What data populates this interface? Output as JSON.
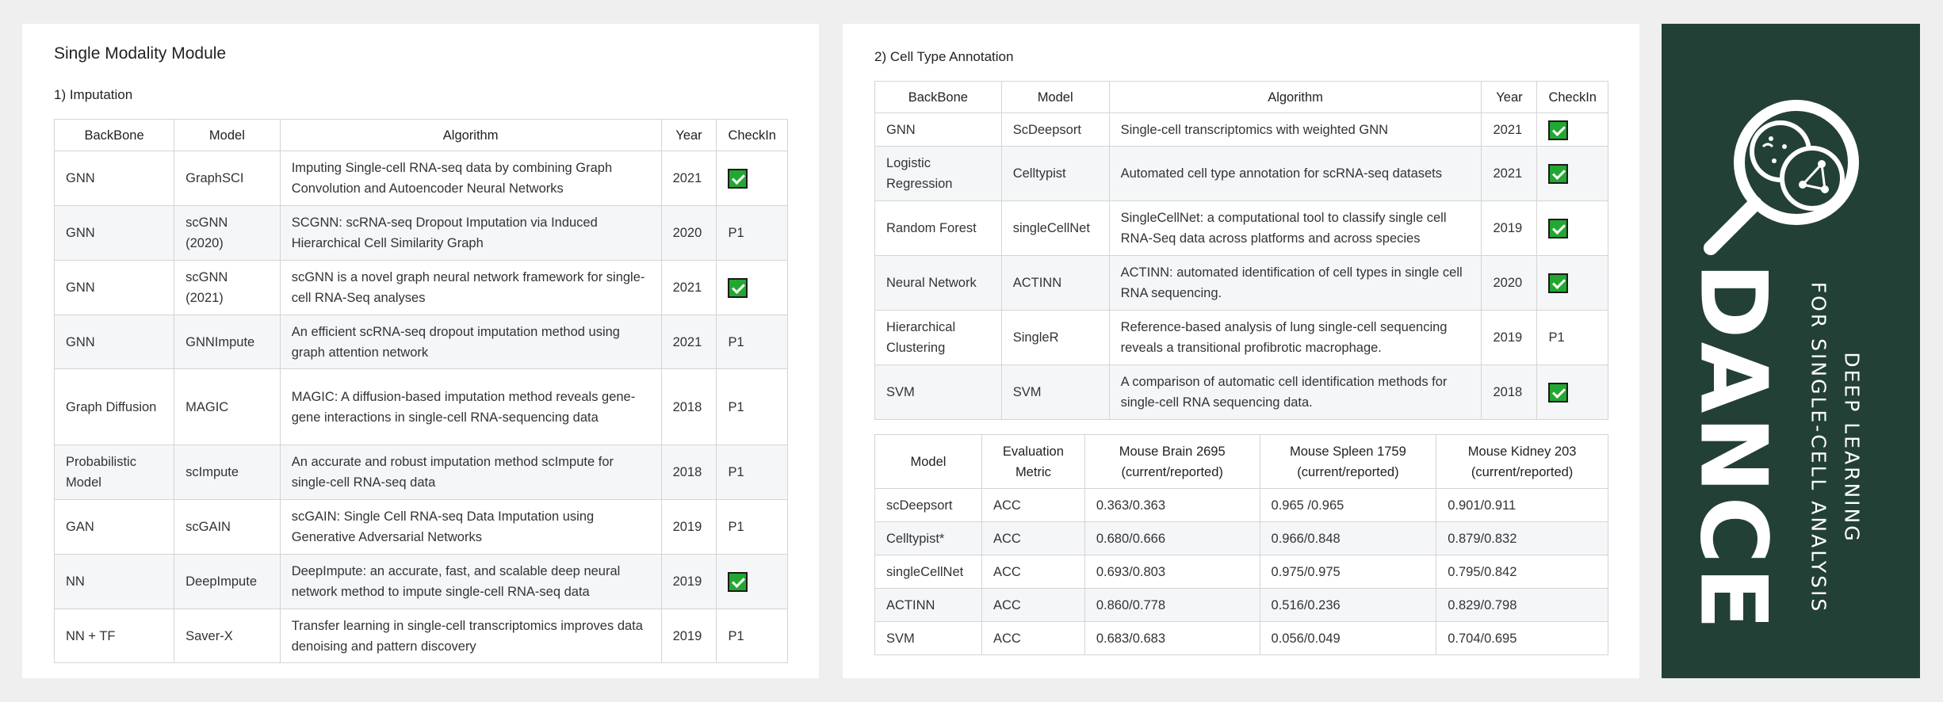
{
  "left": {
    "title": "Single Modality Module",
    "section": "1)  Imputation",
    "headers": [
      "BackBone",
      "Model",
      "Algorithm",
      "Year",
      "CheckIn"
    ],
    "rows": [
      {
        "backbone": "GNN",
        "model": "GraphSCI",
        "algorithm": "Imputing Single-cell RNA-seq data by combining Graph Convolution and Autoencoder Neural Networks",
        "year": "2021",
        "checkin": "check"
      },
      {
        "backbone": "GNN",
        "model": "scGNN (2020)",
        "algorithm": "SCGNN: scRNA-seq Dropout Imputation via Induced Hierarchical Cell Similarity Graph",
        "year": "2020",
        "checkin": "P1"
      },
      {
        "backbone": "GNN",
        "model": "scGNN (2021)",
        "algorithm": "scGNN is a novel graph neural network framework for single-cell RNA-Seq analyses",
        "year": "2021",
        "checkin": "check"
      },
      {
        "backbone": "GNN",
        "model": "GNNImpute",
        "algorithm": "An efficient scRNA-seq dropout imputation method using graph attention network",
        "year": "2021",
        "checkin": "P1"
      },
      {
        "backbone": "Graph Diffusion",
        "model": "MAGIC",
        "algorithm": "MAGIC: A diffusion-based imputation method reveals gene-gene interactions in single-cell RNA-sequencing data",
        "year": "2018",
        "checkin": "P1"
      },
      {
        "backbone": "Probabilistic Model",
        "model": "scImpute",
        "algorithm": "An accurate and robust imputation method scImpute for single-cell RNA-seq data",
        "year": "2018",
        "checkin": "P1"
      },
      {
        "backbone": "GAN",
        "model": "scGAIN",
        "algorithm": "scGAIN: Single Cell RNA-seq Data Imputation using Generative Adversarial Networks",
        "year": "2019",
        "checkin": "P1"
      },
      {
        "backbone": "NN",
        "model": "DeepImpute",
        "algorithm": "DeepImpute: an accurate, fast, and scalable deep neural network method to impute single-cell RNA-seq data",
        "year": "2019",
        "checkin": "check"
      },
      {
        "backbone": "NN + TF",
        "model": "Saver-X",
        "algorithm": "Transfer learning in single-cell transcriptomics improves data denoising and pattern discovery",
        "year": "2019",
        "checkin": "P1"
      }
    ]
  },
  "middle": {
    "section": "2)  Cell Type Annotation",
    "headers": [
      "BackBone",
      "Model",
      "Algorithm",
      "Year",
      "CheckIn"
    ],
    "rows": [
      {
        "backbone": "GNN",
        "model": "ScDeepsort",
        "algorithm": "Single-cell transcriptomics with weighted GNN",
        "year": "2021",
        "checkin": "check"
      },
      {
        "backbone": "Logistic Regression",
        "model": "Celltypist",
        "algorithm": "Automated cell type annotation for scRNA-seq datasets",
        "year": "2021",
        "checkin": "check"
      },
      {
        "backbone": "Random Forest",
        "model": "singleCellNet",
        "algorithm": "SingleCellNet: a computational tool to classify single cell RNA-Seq data across platforms and across species",
        "year": "2019",
        "checkin": "check"
      },
      {
        "backbone": "Neural Network",
        "model": "ACTINN",
        "algorithm": "ACTINN: automated identification of cell types in single cell RNA sequencing.",
        "year": "2020",
        "checkin": "check"
      },
      {
        "backbone": "Hierarchical Clustering",
        "model": "SingleR",
        "algorithm": "Reference-based analysis of lung single-cell sequencing reveals a transitional profibrotic macrophage.",
        "year": "2019",
        "checkin": "P1"
      },
      {
        "backbone": "SVM",
        "model": "SVM",
        "algorithm": "A comparison of automatic cell identification methods for single-cell RNA sequencing data.",
        "year": "2018",
        "checkin": "check"
      }
    ],
    "eval_headers": [
      "Model",
      "Evaluation Metric",
      "Mouse Brain 2695 (current/reported)",
      "Mouse Spleen 1759 (current/reported)",
      "Mouse Kidney 203 (current/reported)"
    ],
    "eval_rows": [
      {
        "model": "scDeepsort",
        "metric": "ACC",
        "brain": "0.363/0.363",
        "spleen": "0.965 /0.965",
        "kidney": "0.901/0.911"
      },
      {
        "model": "Celltypist*",
        "metric": "ACC",
        "brain": "0.680/0.666",
        "spleen": "0.966/0.848",
        "kidney": "0.879/0.832"
      },
      {
        "model": "singleCellNet",
        "metric": "ACC",
        "brain": "0.693/0.803",
        "spleen": "0.975/0.975",
        "kidney": "0.795/0.842"
      },
      {
        "model": "ACTINN",
        "metric": "ACC",
        "brain": "0.860/0.778",
        "spleen": "0.516/0.236",
        "kidney": "0.829/0.798"
      },
      {
        "model": "SVM",
        "metric": "ACC",
        "brain": "0.683/0.683",
        "spleen": "0.056/0.049",
        "kidney": "0.704/0.695"
      }
    ]
  },
  "brand": {
    "name": "DANCE",
    "tagline_1": "DEEP LEARNING",
    "tagline_2": "FOR SINGLE-CELL ANALYSIS",
    "logo_icon": "magnifier-cells-icon",
    "panel_color": "#234036"
  },
  "colors": {
    "check_green": "#22a831",
    "row_alt": "#f5f6f8",
    "border": "#d4d4d4"
  }
}
